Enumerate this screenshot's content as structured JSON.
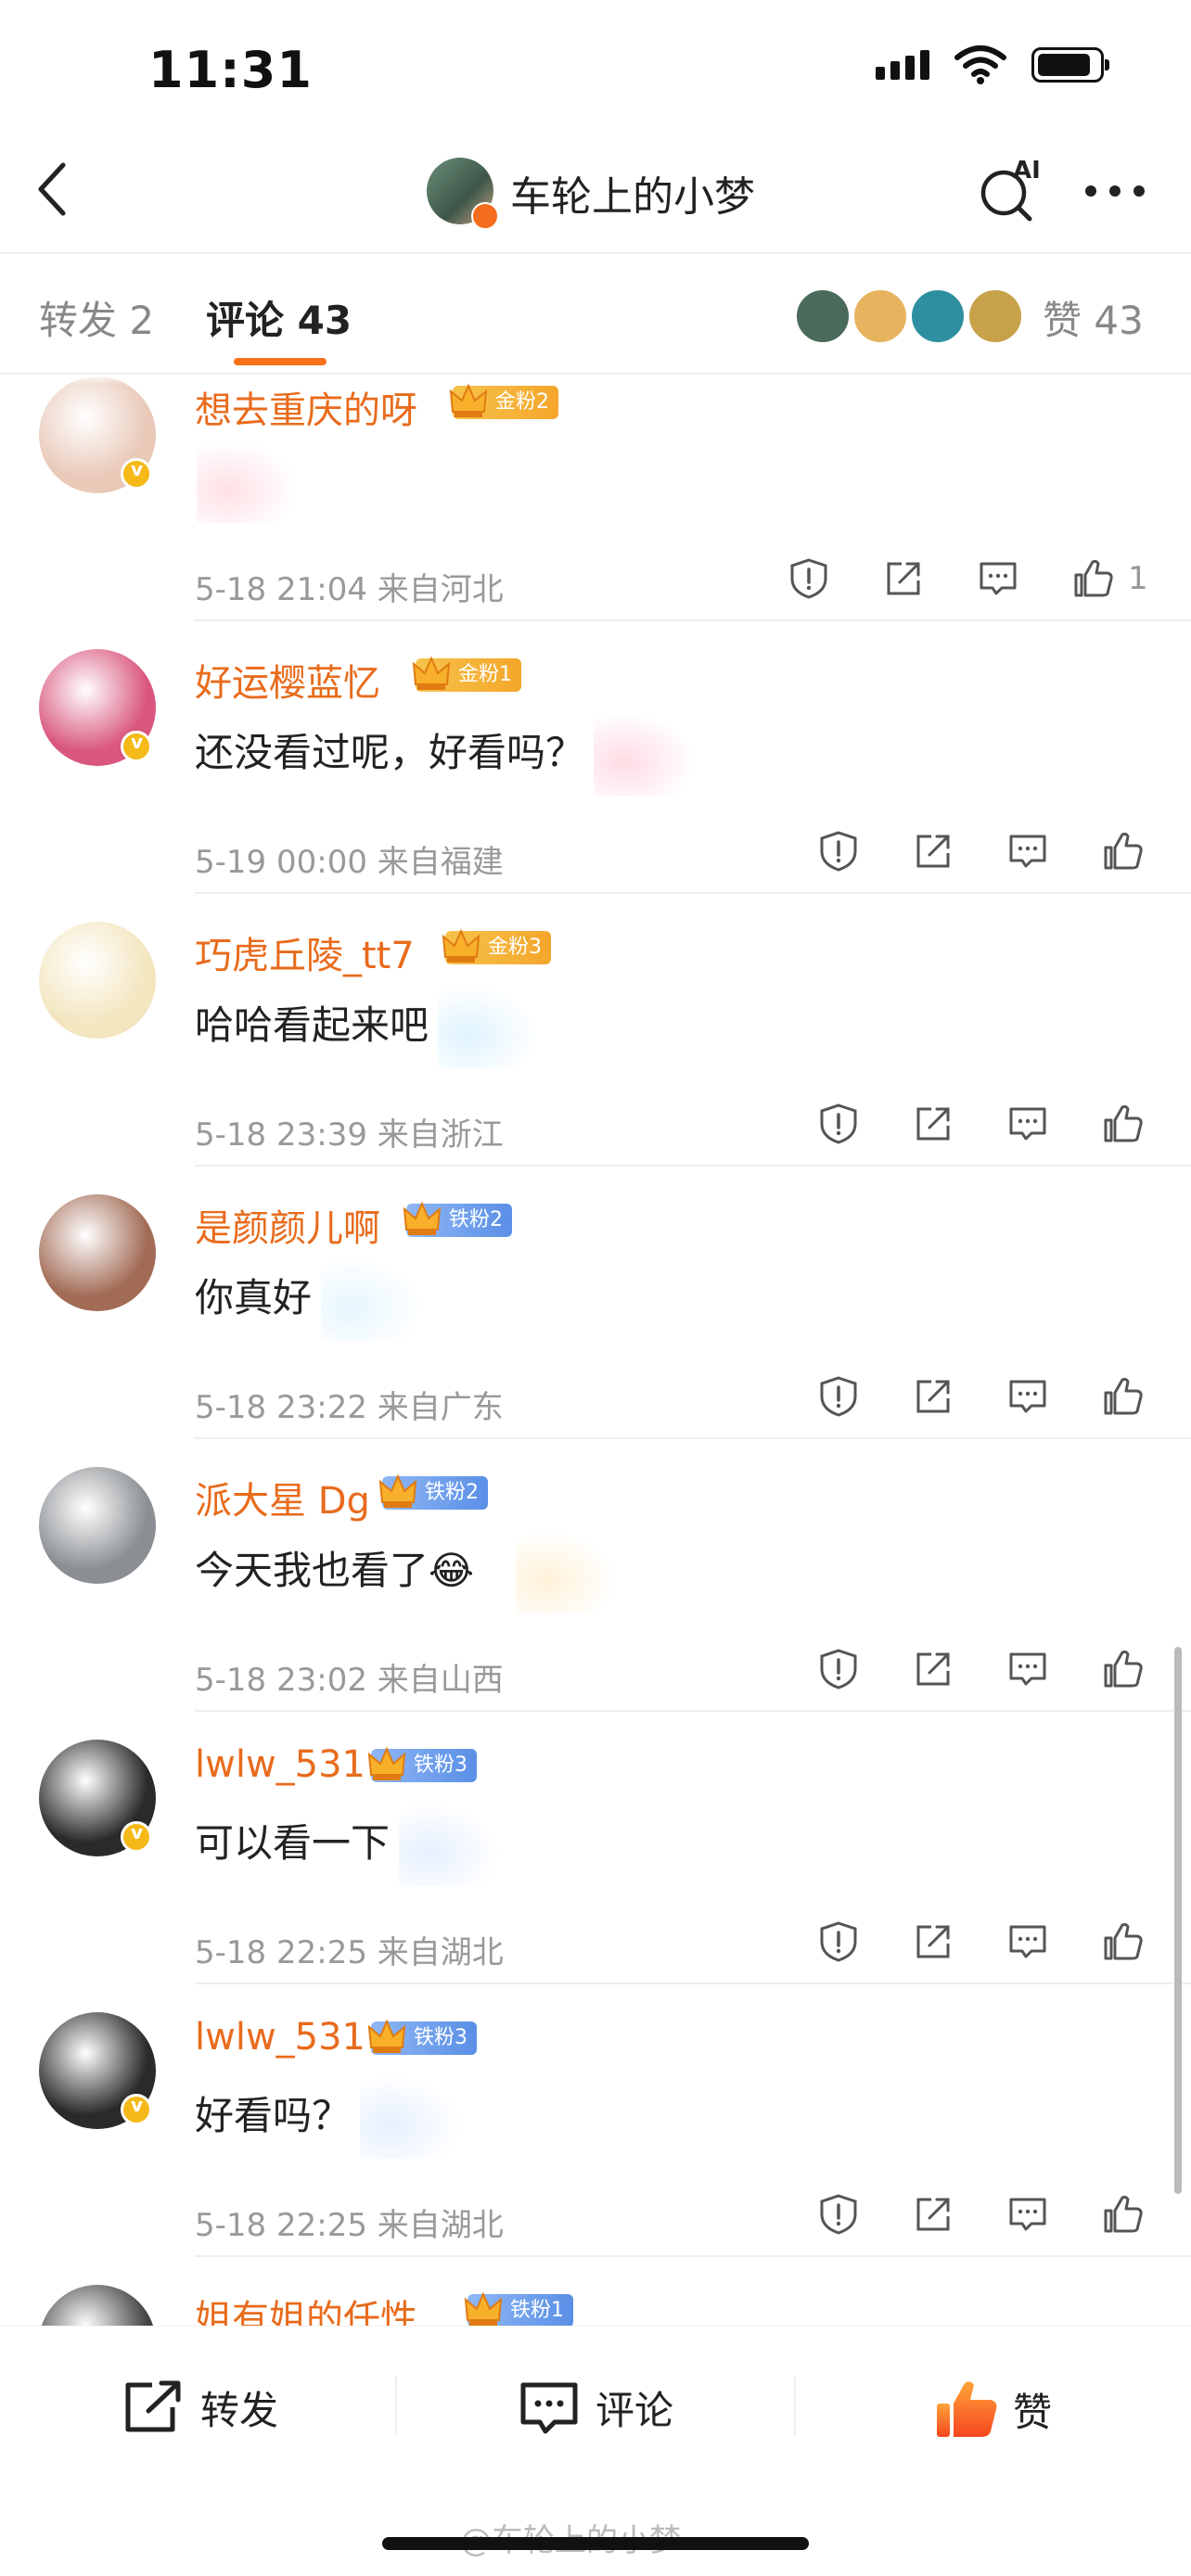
{
  "status_bar": {
    "time": "11:31",
    "battery_level": 0.88
  },
  "nav": {
    "title": "车轮上的小梦",
    "ai_label": "AI"
  },
  "tabs": {
    "repost": "转发 2",
    "comment": "评论 43",
    "like": "赞 43"
  },
  "comments": [
    {
      "name": "想去重庆的呀",
      "fan": "金粉2",
      "fan_type": "gold",
      "text": "",
      "meta": "5-18 21:04  来自河北",
      "likes": "1",
      "verified": true,
      "avatar": "#e9c9b8"
    },
    {
      "name": "好运樱蓝忆",
      "fan": "金粉1",
      "fan_type": "gold",
      "text": "还没看过呢，好看吗？",
      "meta": "5-19 00:00  来自福建",
      "likes": "",
      "verified": true,
      "avatar": "#d9567d"
    },
    {
      "name": "巧虎丘陵_tt7",
      "fan": "金粉3",
      "fan_type": "gold",
      "text": "哈哈看起来吧",
      "meta": "5-18 23:39  来自浙江",
      "likes": "",
      "verified": false,
      "avatar": "#f3e6bf"
    },
    {
      "name": "是颜颜儿啊",
      "fan": "铁粉2",
      "fan_type": "iron",
      "text": "你真好",
      "meta": "5-18 23:22  来自广东",
      "likes": "",
      "verified": false,
      "avatar": "#a26b55"
    },
    {
      "name": "派大星 Dg",
      "fan": "铁粉2",
      "fan_type": "iron",
      "text": "今天我也看了😂",
      "meta": "5-18 23:02  来自山西",
      "likes": "",
      "verified": false,
      "avatar": "#8b8f93"
    },
    {
      "name": "lwlw_531",
      "fan": "铁粉3",
      "fan_type": "iron",
      "text": "可以看一下",
      "meta": "5-18 22:25  来自湖北",
      "likes": "",
      "verified": true,
      "avatar": "#2a2a2a"
    },
    {
      "name": "lwlw_531",
      "fan": "铁粉3",
      "fan_type": "iron",
      "text": "好看吗？",
      "meta": "5-18 22:25  来自湖北",
      "likes": "",
      "verified": true,
      "avatar": "#2a2a2a"
    },
    {
      "name": "姐有姐的任性_",
      "fan": "铁粉1",
      "fan_type": "iron",
      "text": "",
      "meta": "",
      "likes": "",
      "verified": false,
      "avatar": "#444"
    }
  ],
  "bottom": {
    "repost": "转发",
    "comment": "评论",
    "like": "赞"
  },
  "watermark": "@车轮上的小梦",
  "colors": {
    "accent": "#f7731b",
    "name": "#e86b1c",
    "meta": "#999999"
  }
}
